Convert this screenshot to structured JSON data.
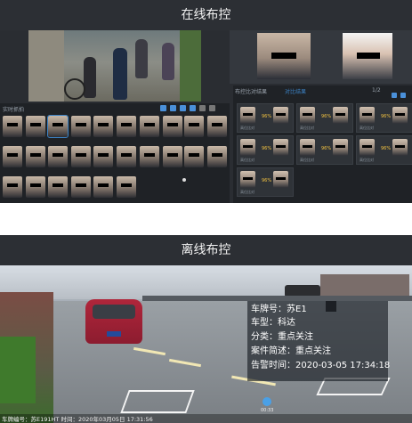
{
  "online": {
    "title": "在线布控",
    "list_header": "实时抓拍",
    "results_header": "布控比对结果",
    "results_tab": "对比结果",
    "card_labels": [
      "高位比对",
      "高位比对",
      "高位比对"
    ],
    "card_percent": "96%",
    "pager": "1/2"
  },
  "offline": {
    "title": "离线布控",
    "info": {
      "plate_label": "车牌号：",
      "plate_value": "苏E1",
      "model_label": "车型：",
      "model_value": "科达",
      "category_label": "分类：",
      "category_value": "重点关注",
      "case_label": "案件简述：",
      "case_value": "重点关注",
      "time_label": "告警时间：",
      "time_value": "2020-03-05 17:34:18"
    },
    "overlay_text": "车牌编号：苏E191HT 时间：2020年03月05日 17:31:56",
    "player_time": "00:33"
  },
  "colors": {
    "dark_bg": "#2a2d32",
    "accent": "#3b82c4",
    "warning": "#f0c040"
  }
}
